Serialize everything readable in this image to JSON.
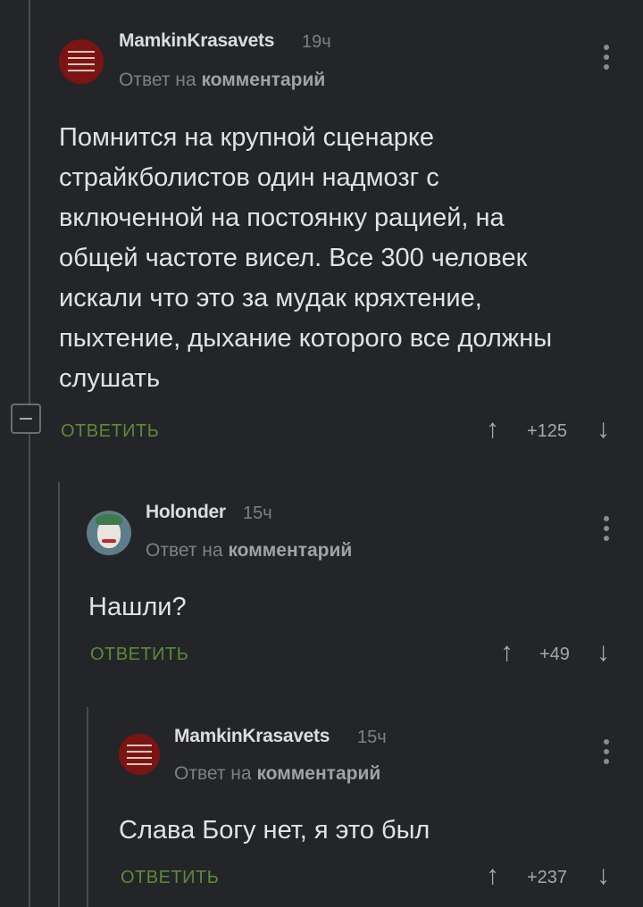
{
  "comments": [
    {
      "username": "MamkinKrasavets",
      "time": "19ч",
      "reply_prefix": "Ответ на",
      "reply_target": "комментарий",
      "text_lines": [
        "Помнится на крупной сценарке",
        "страйкболистов один надмозг с",
        "включенной на постоянку рацией, на",
        "общей частоте висел. Все 300 человек",
        "искали что это за мудак кряхтение,",
        "пыхтение, дыхание которого все должны",
        "слушать"
      ],
      "reply_label": "ОТВЕТИТЬ",
      "score": "+125",
      "avatar_icon": "red-text-badge-avatar"
    },
    {
      "username": "Holonder",
      "time": "15ч",
      "reply_prefix": "Ответ на",
      "reply_target": "комментарий",
      "text_lines": [
        "Нашли?"
      ],
      "reply_label": "ОТВЕТИТЬ",
      "score": "+49",
      "avatar_icon": "joker-avatar"
    },
    {
      "username": "MamkinKrasavets",
      "time": "15ч",
      "reply_prefix": "Ответ на",
      "reply_target": "комментарий",
      "text_lines": [
        "Слава Богу нет, я это был"
      ],
      "reply_label": "ОТВЕТИТЬ",
      "score": "+237",
      "avatar_icon": "red-text-badge-avatar"
    }
  ],
  "icons": {
    "up": "↑",
    "down": "↓",
    "menu": "vertical-dots-icon",
    "collapse": "minus-square-icon"
  },
  "colors": {
    "background": "#242528",
    "reply_button": "#5e8a3a",
    "username": "#dcdcdc",
    "muted": "#7e8084"
  }
}
